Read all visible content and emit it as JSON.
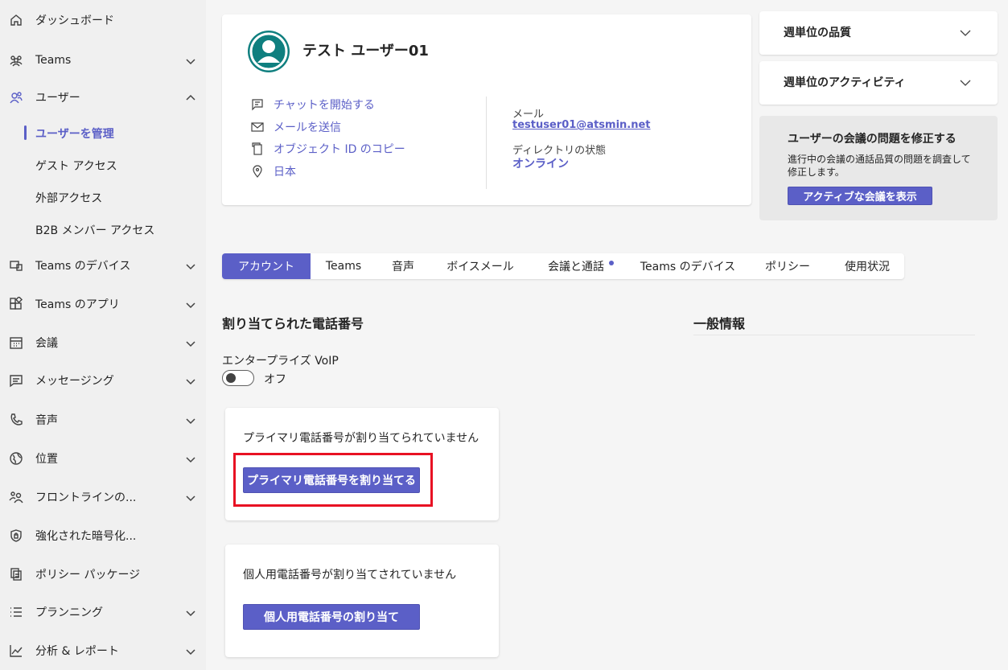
{
  "sidebar": {
    "items": [
      {
        "label": "ダッシュボード",
        "icon": "home-icon",
        "chevron": ""
      },
      {
        "label": "Teams",
        "icon": "teams-icon",
        "chevron": "down"
      },
      {
        "label": "ユーザー",
        "icon": "users-icon",
        "chevron": "up"
      },
      {
        "label": "Teams のデバイス",
        "icon": "devices-icon",
        "chevron": "down"
      },
      {
        "label": "Teams のアプリ",
        "icon": "apps-icon",
        "chevron": "down"
      },
      {
        "label": "会議",
        "icon": "calendar-icon",
        "chevron": "down"
      },
      {
        "label": "メッセージング",
        "icon": "chat-icon",
        "chevron": "down"
      },
      {
        "label": "音声",
        "icon": "phone-icon",
        "chevron": "down"
      },
      {
        "label": "位置",
        "icon": "globe-icon",
        "chevron": "down"
      },
      {
        "label": "フロントラインの...",
        "icon": "frontline-icon",
        "chevron": "down"
      },
      {
        "label": "強化された暗号化...",
        "icon": "shield-lock-icon",
        "chevron": ""
      },
      {
        "label": "ポリシー パッケージ",
        "icon": "policy-package-icon",
        "chevron": ""
      },
      {
        "label": "プランニング",
        "icon": "list-icon",
        "chevron": "down"
      },
      {
        "label": "分析 & レポート",
        "icon": "chart-icon",
        "chevron": "down"
      }
    ],
    "user_subitems": [
      {
        "label": "ユーザーを管理",
        "active": true
      },
      {
        "label": "ゲスト アクセス",
        "active": false
      },
      {
        "label": "外部アクセス",
        "active": false
      },
      {
        "label": "B2B メンバー アクセス",
        "active": false
      }
    ]
  },
  "profile": {
    "name": "テスト ユーザー01",
    "actions": [
      {
        "label": "チャットを開始する",
        "icon": "chat-icon"
      },
      {
        "label": "メールを送信",
        "icon": "mail-icon"
      },
      {
        "label": "オブジェクト ID のコピー",
        "icon": "copy-icon"
      },
      {
        "label": "日本",
        "icon": "location-icon"
      }
    ],
    "email_label": "メール",
    "email": "testuser01@atsmin.net",
    "directory_label": "ディレクトリの状態",
    "directory_status": "オンライン"
  },
  "right_panel": {
    "quality_title": "週単位の品質",
    "activity_title": "週単位のアクティビティ",
    "fix_title": "ユーザーの会議の問題を修正する",
    "fix_desc": "進行中の会議の通話品質の問題を調査して修正します。",
    "fix_button": "アクティブな会議を表示"
  },
  "tabs": [
    {
      "label": "アカウント",
      "active": true,
      "dot": false
    },
    {
      "label": "Teams",
      "active": false,
      "dot": false
    },
    {
      "label": "音声",
      "active": false,
      "dot": false
    },
    {
      "label": "ボイスメール",
      "active": false,
      "dot": false
    },
    {
      "label": "会議と通話",
      "active": false,
      "dot": true
    },
    {
      "label": "Teams のデバイス",
      "active": false,
      "dot": false
    },
    {
      "label": "ポリシー",
      "active": false,
      "dot": false
    },
    {
      "label": "使用状況",
      "active": false,
      "dot": false
    }
  ],
  "account": {
    "phone_section_title": "割り当てられた電話番号",
    "general_section_title": "一般情報",
    "voip_label": "エンタープライズ VoIP",
    "voip_state": "オフ",
    "primary_text": "プライマリ電話番号が割り当てられていません",
    "primary_button": "プライマリ電話番号を割り当てる",
    "private_text": "個人用電話番号が割り当てされていません",
    "private_button": "個人用電話番号の割り当て"
  },
  "colors": {
    "accent": "#5b5fc7",
    "highlight": "#e81123",
    "avatar": "#0f7f7f"
  }
}
